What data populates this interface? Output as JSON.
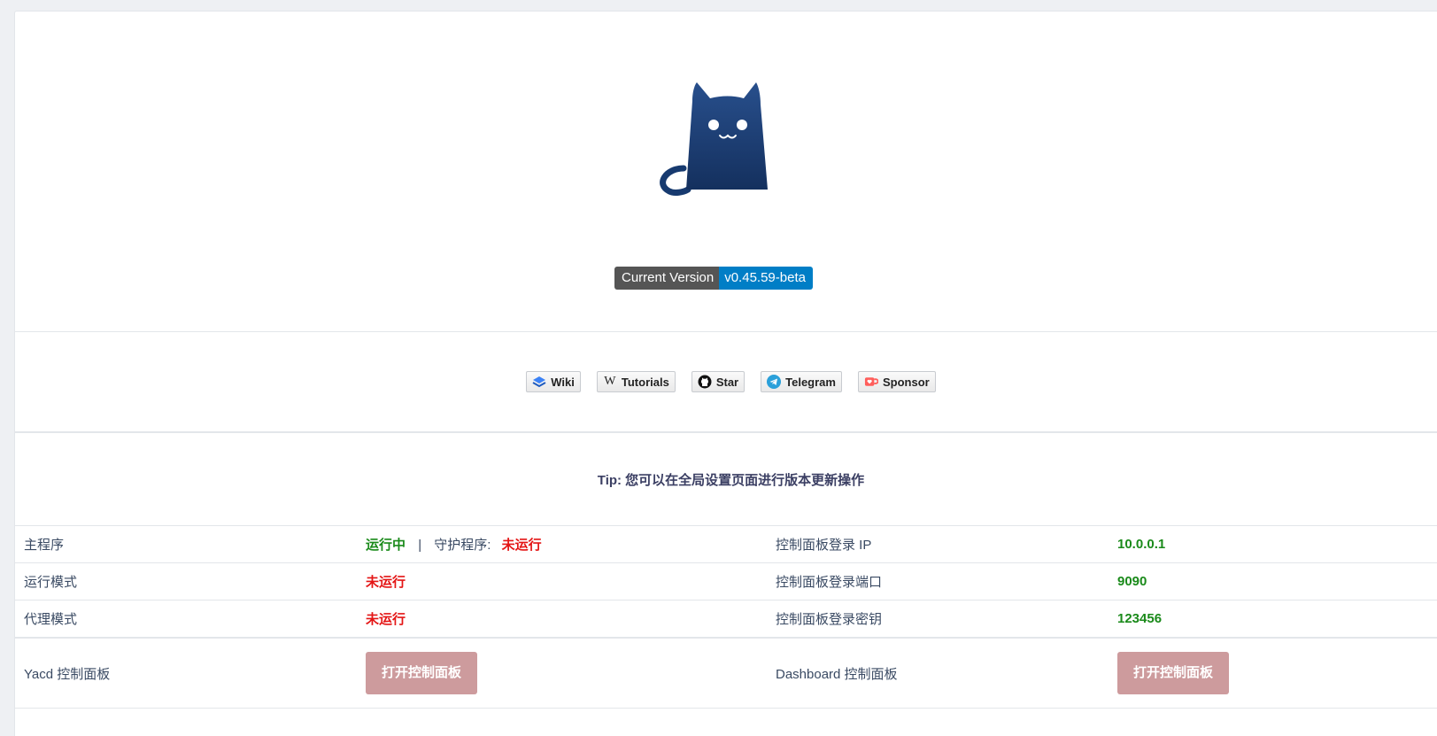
{
  "version": {
    "key": "Current Version",
    "value": "v0.45.59-beta"
  },
  "links": [
    {
      "label": "Wiki",
      "icon": "book-icon"
    },
    {
      "label": "Tutorials",
      "icon": "wikipedia-icon"
    },
    {
      "label": "Star",
      "icon": "github-icon"
    },
    {
      "label": "Telegram",
      "icon": "telegram-icon"
    },
    {
      "label": "Sponsor",
      "icon": "kofi-cup-icon"
    }
  ],
  "tip": "Tip: 您可以在全局设置页面进行版本更新操作",
  "status": {
    "main_label": "主程序",
    "main_value": "运行中",
    "pipe": "|",
    "daemon_label": "守护程序:",
    "daemon_value": "未运行",
    "mode_label": "运行模式",
    "mode_value": "未运行",
    "proxy_label": "代理模式",
    "proxy_value": "未运行",
    "ip_label": "控制面板登录 IP",
    "ip_value": "10.0.0.1",
    "port_label": "控制面板登录端口",
    "port_value": "9090",
    "secret_label": "控制面板登录密钥",
    "secret_value": "123456",
    "yacd_label": "Yacd 控制面板",
    "yacd_button": "打开控制面板",
    "dashboard_label": "Dashboard 控制面板",
    "dashboard_button": "打开控制面板"
  },
  "colors": {
    "ok": "#1a8a1a",
    "bad": "#e41515",
    "button": "#cd9b9d",
    "badge_value": "#007ec6"
  }
}
